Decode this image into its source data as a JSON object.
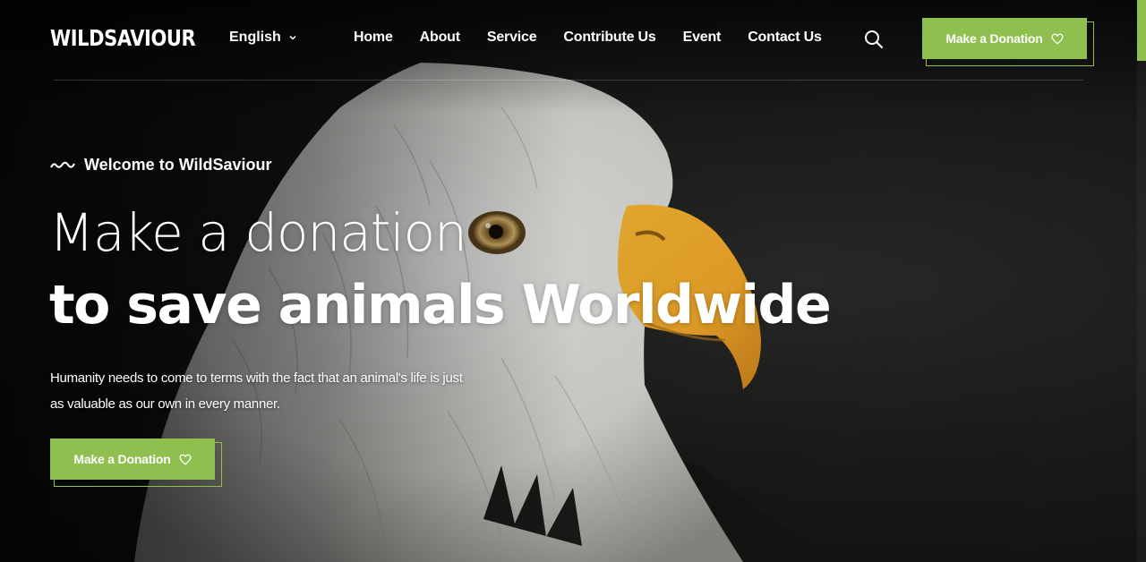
{
  "brand": {
    "logo": "WILDSAVIOUR",
    "accent_color": "#8fbf4f"
  },
  "header": {
    "language": {
      "selected": "English",
      "icon": "chevron-down-icon"
    },
    "nav": [
      {
        "label": "Home"
      },
      {
        "label": "About"
      },
      {
        "label": "Service"
      },
      {
        "label": "Contribute Us"
      },
      {
        "label": "Event"
      },
      {
        "label": "Contact Us"
      }
    ],
    "search_icon": "search-icon",
    "donate_button": {
      "label": "Make a Donation",
      "icon": "heart-icon"
    }
  },
  "hero": {
    "welcome": "Welcome to WildSaviour",
    "welcome_icon": "wave-icon",
    "headline_line1": "Make a donation",
    "headline_line2": "to save animals Worldwide",
    "intro_line1": "Humanity needs to come to terms with the fact that an animal's life is just",
    "intro_line2": "as valuable as our own in every manner.",
    "donate_button": {
      "label": "Make a Donation",
      "icon": "heart-icon"
    },
    "background_image": "bald-eagle-portrait"
  }
}
